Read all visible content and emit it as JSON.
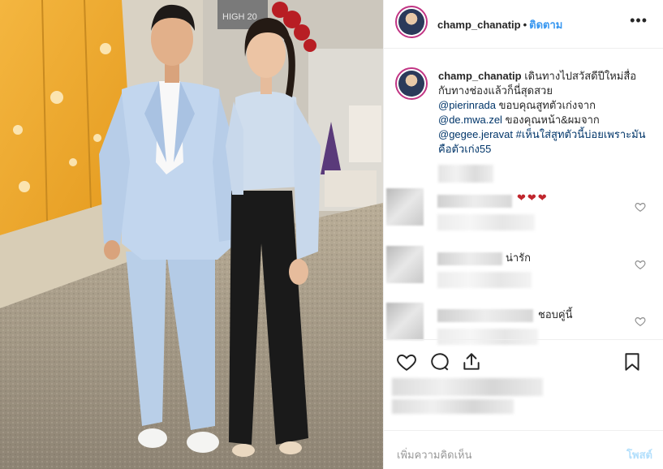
{
  "post": {
    "username": "champ_chanatip",
    "follow_label": "ติดตาม",
    "more_label": "•••"
  },
  "photo": {
    "sign_text": "HIGH 20"
  },
  "caption": {
    "username": "champ_chanatip",
    "line1": "เดินทางไปสวัสดีปีใหม่สื่อกับทางช่องแล้วก็นี่สุดสวย",
    "mention1": "@pierinrada",
    "text2": "ขอบคุณสูทตัวเก่งจาก",
    "mention2": "@de.mwa.zel",
    "text3": "ของคุณหน้า&ผมจาก",
    "mention3": "@gegee.jeravat",
    "hashtag": "#เห็นใส่สูทตัวนี้บ่อยเพราะมันคือตัวเก่ง55"
  },
  "comments": [
    {
      "text": "❤❤❤"
    },
    {
      "text": "น่ารัก"
    },
    {
      "text": "ชอบคู่นี้"
    }
  ],
  "add_comment": {
    "placeholder": "เพิ่มความคิดเห็น",
    "post_label": "โพสต์"
  },
  "icons": [
    "heart-icon",
    "comment-icon",
    "share-icon",
    "bookmark-icon",
    "more-icon"
  ],
  "colors": {
    "link": "#3897f0",
    "mention": "#003569",
    "post_disabled": "#b2dffc",
    "heart_red": "#c0262d"
  }
}
